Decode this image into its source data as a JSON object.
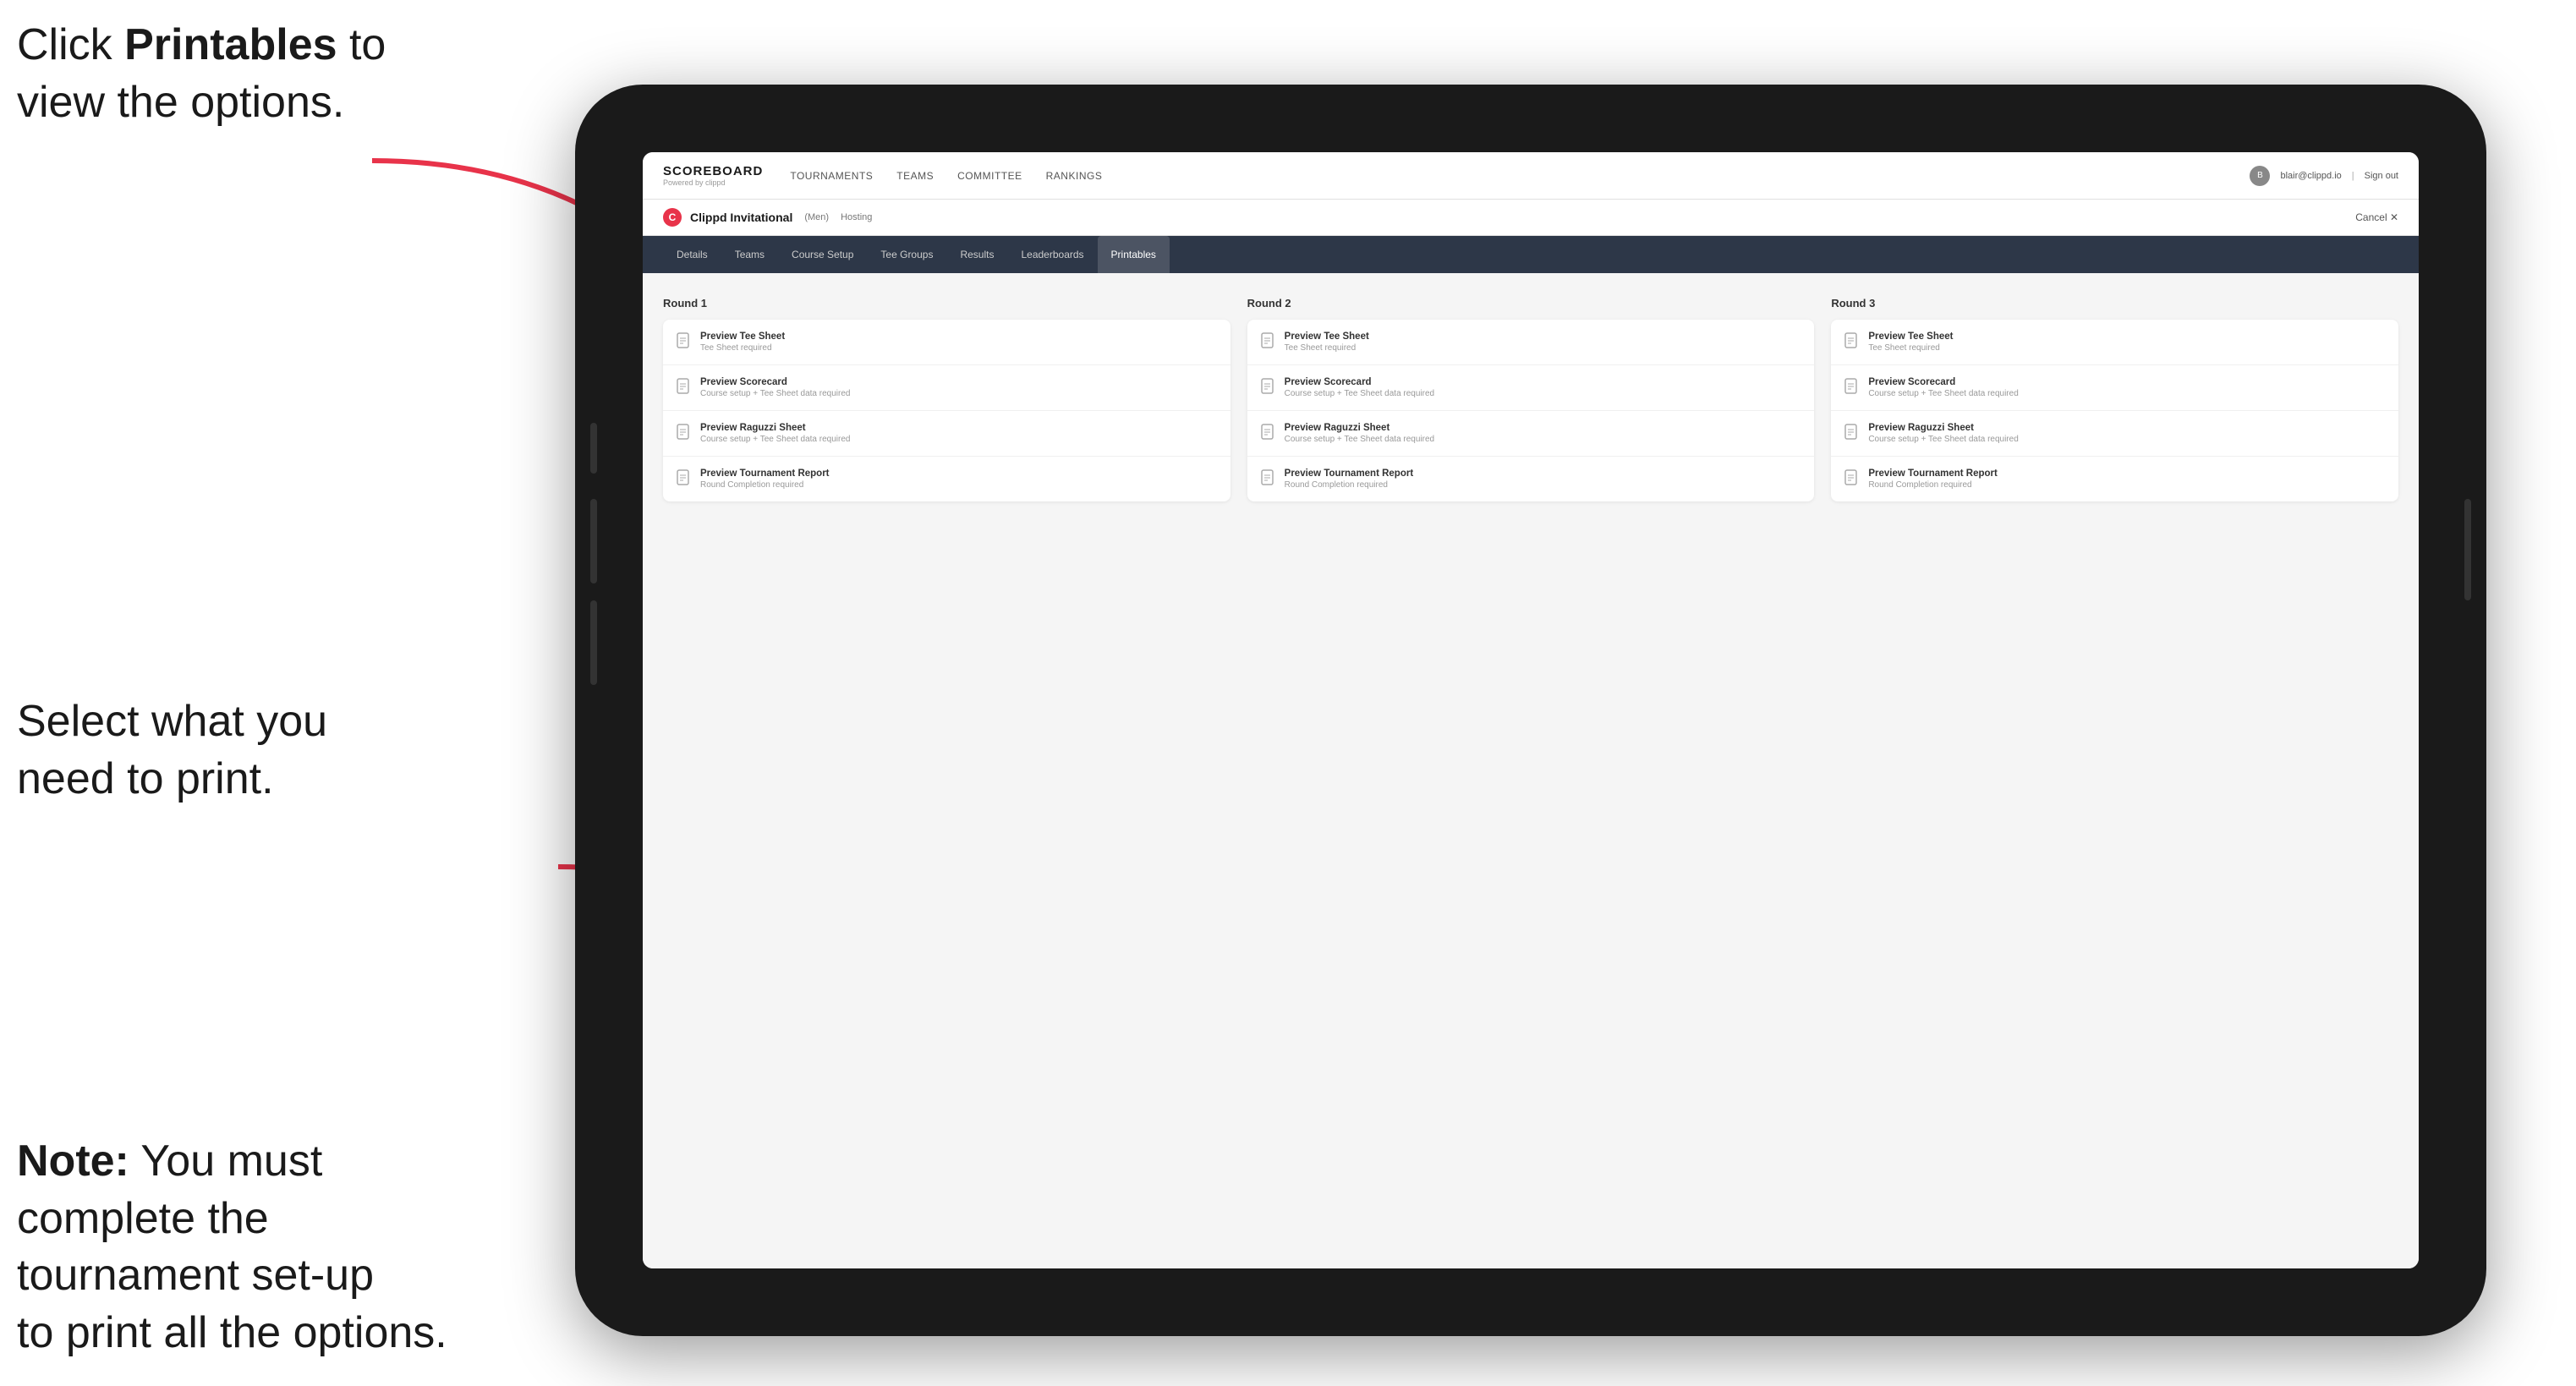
{
  "instructions": {
    "top": {
      "prefix": "Click ",
      "bold": "Printables",
      "suffix": " to\nview the options."
    },
    "middle": {
      "text": "Select what you\nneed to print."
    },
    "bottom": {
      "bold": "Note:",
      "text": " You must\ncomplete the\ntournament set-up\nto print all the options."
    }
  },
  "topNav": {
    "logo": "SCOREBOARD",
    "poweredBy": "Powered by clippd",
    "items": [
      "TOURNAMENTS",
      "TEAMS",
      "COMMITTEE",
      "RANKINGS"
    ],
    "userEmail": "blair@clippd.io",
    "signOut": "Sign out"
  },
  "tournamentHeader": {
    "icon": "C",
    "name": "Clippd Invitational",
    "bracket": "(Men)",
    "status": "Hosting",
    "cancel": "Cancel ✕"
  },
  "subNav": {
    "items": [
      "Details",
      "Teams",
      "Course Setup",
      "Tee Groups",
      "Results",
      "Leaderboards",
      "Printables"
    ],
    "active": "Printables"
  },
  "rounds": [
    {
      "title": "Round 1",
      "items": [
        {
          "title": "Preview Tee Sheet",
          "subtitle": "Tee Sheet required"
        },
        {
          "title": "Preview Scorecard",
          "subtitle": "Course setup + Tee Sheet data required"
        },
        {
          "title": "Preview Raguzzi Sheet",
          "subtitle": "Course setup + Tee Sheet data required"
        },
        {
          "title": "Preview Tournament Report",
          "subtitle": "Round Completion required"
        }
      ]
    },
    {
      "title": "Round 2",
      "items": [
        {
          "title": "Preview Tee Sheet",
          "subtitle": "Tee Sheet required"
        },
        {
          "title": "Preview Scorecard",
          "subtitle": "Course setup + Tee Sheet data required"
        },
        {
          "title": "Preview Raguzzi Sheet",
          "subtitle": "Course setup + Tee Sheet data required"
        },
        {
          "title": "Preview Tournament Report",
          "subtitle": "Round Completion required"
        }
      ]
    },
    {
      "title": "Round 3",
      "items": [
        {
          "title": "Preview Tee Sheet",
          "subtitle": "Tee Sheet required"
        },
        {
          "title": "Preview Scorecard",
          "subtitle": "Course setup + Tee Sheet data required"
        },
        {
          "title": "Preview Raguzzi Sheet",
          "subtitle": "Course setup + Tee Sheet data required"
        },
        {
          "title": "Preview Tournament Report",
          "subtitle": "Round Completion required"
        }
      ]
    }
  ],
  "colors": {
    "accent": "#e8334a",
    "navBg": "#2d3748",
    "activeTab": "rgba(255,255,255,0.15)"
  }
}
